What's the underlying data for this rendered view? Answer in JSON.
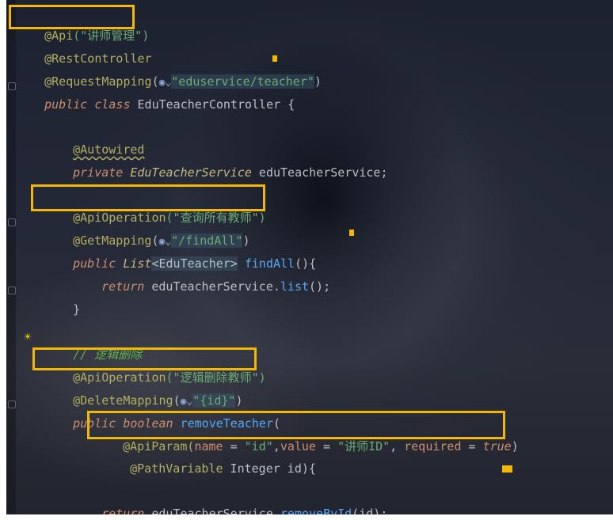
{
  "code": {
    "l1_ann": "@Api",
    "l1_str": "(\"讲师管理\")",
    "l2_ann": "@RestController",
    "l3_ann": "@RequestMapping",
    "l3_paren": "(",
    "l3_str": "\"eduservice/teacher\"",
    "l3_close": ")",
    "l4_kw1": "public",
    "l4_kw2": "class",
    "l4_cls": "EduTeacherController {",
    "l6_ann": "@Autowired",
    "l7_kw": "private",
    "l7_type": "EduTeacherService",
    "l7_rest": " eduTeacherService;",
    "l9_ann": "@ApiOperation",
    "l9_str": "(\"查询所有教师\")",
    "l10_ann": "@GetMapping",
    "l10_paren": "(",
    "l10_str": "\"/findAll\"",
    "l10_close": ")",
    "l11_kw": "public",
    "l11_type": "List",
    "l11_generic": "<EduTeacher>",
    "l11_fn": "findAll",
    "l11_rest": "(){",
    "l12_kw": "return",
    "l12_obj": " eduTeacherService.",
    "l12_fn": "list",
    "l12_rest": "();",
    "l13_brace": "}",
    "l15_cmt": "// 逻辑删除",
    "l16_ann": "@ApiOperation",
    "l16_str": "(\"逻辑删除教师\")",
    "l17_ann": "@DeleteMapping",
    "l17_paren": "(",
    "l17_str": "\"{id}\"",
    "l17_close": ")",
    "l18_kw1": "public",
    "l18_kw2": "boolean",
    "l18_fn": "removeTeacher",
    "l18_rest": "(",
    "l19_ann": "@ApiParam(",
    "l19_p1": "name",
    "l19_eq1": " = ",
    "l19_s1": "\"id\"",
    "l19_comma1": ",",
    "l19_p2": "value",
    "l19_eq2": " = ",
    "l19_s2": "\"讲师ID\"",
    "l19_comma2": ", ",
    "l19_p3": "required",
    "l19_eq3": " = ",
    "l19_lit": "true",
    "l19_close": ")",
    "l20_ann": "@PathVariable",
    "l20_rest": " Integer id){",
    "l22_kw": "return",
    "l22_obj": " eduTeacherService.",
    "l22_fn": "removeById",
    "l22_rest": "(id);",
    "l23_brace": "}"
  },
  "icons": {
    "globe": "web-globe-icon",
    "bulb": "lightbulb-icon"
  },
  "colors": {
    "highlight_box": "#f5b800"
  }
}
